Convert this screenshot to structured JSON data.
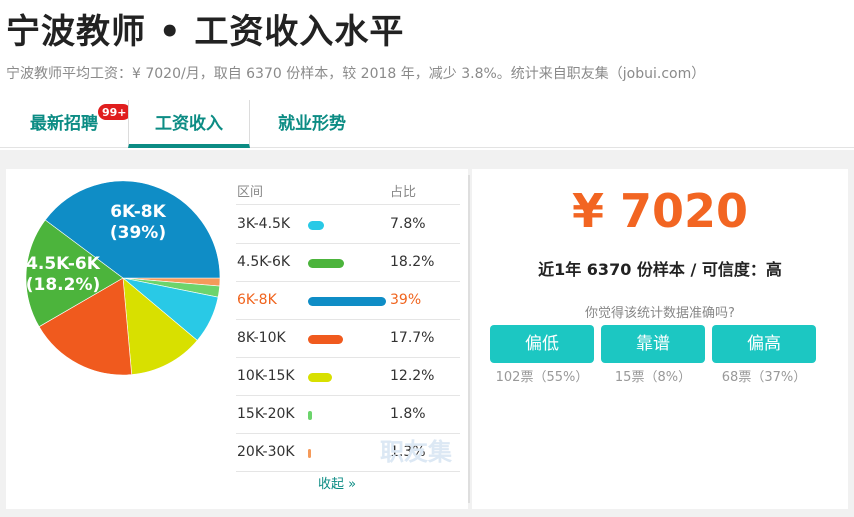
{
  "header": {
    "title": "宁波教师 • 工资收入水平",
    "subtitle": "宁波教师平均工资：¥ 7020/月，取自 6370 份样本，较 2018 年，减少 3.8%。统计来自职友集（jobui.com）"
  },
  "tabs": [
    {
      "label": "最新招聘",
      "badge": "99+"
    },
    {
      "label": "工资收入",
      "active": true
    },
    {
      "label": "就业形势"
    }
  ],
  "table": {
    "col_range": "区间",
    "col_pct": "占比",
    "rows": [
      {
        "range": "3K-4.5K",
        "pct": "7.8%",
        "value": 7.8,
        "color": "#29c9e6"
      },
      {
        "range": "4.5K-6K",
        "pct": "18.2%",
        "value": 18.2,
        "color": "#4cb43c"
      },
      {
        "range": "6K-8K",
        "pct": "39%",
        "value": 39,
        "color": "#0f8dc6",
        "active": true
      },
      {
        "range": "8K-10K",
        "pct": "17.7%",
        "value": 17.7,
        "color": "#f05a1e"
      },
      {
        "range": "10K-15K",
        "pct": "12.2%",
        "value": 12.2,
        "color": "#d8e000"
      },
      {
        "range": "15K-20K",
        "pct": "1.8%",
        "value": 1.8,
        "color": "#6cd46c"
      },
      {
        "range": "20K-30K",
        "pct": "1.3%",
        "value": 1.3,
        "color": "#f59a5a"
      }
    ],
    "collapse_label": "收起 »"
  },
  "pie_labels": {
    "big": {
      "range": "6K-8K",
      "pct": "(39%)"
    },
    "second": {
      "range": "4.5K-6K",
      "pct": "(18.2%)"
    }
  },
  "watermark": "职友集",
  "summary": {
    "salary": "¥ 7020",
    "sample_line": "近1年 6370 份样本 / 可信度：高",
    "question": "你觉得该统计数据准确吗?"
  },
  "votes": [
    {
      "label": "偏低",
      "count": "102票（55%）"
    },
    {
      "label": "靠谱",
      "count": "15票（8%）"
    },
    {
      "label": "偏高",
      "count": "68票（37%）"
    }
  ]
}
